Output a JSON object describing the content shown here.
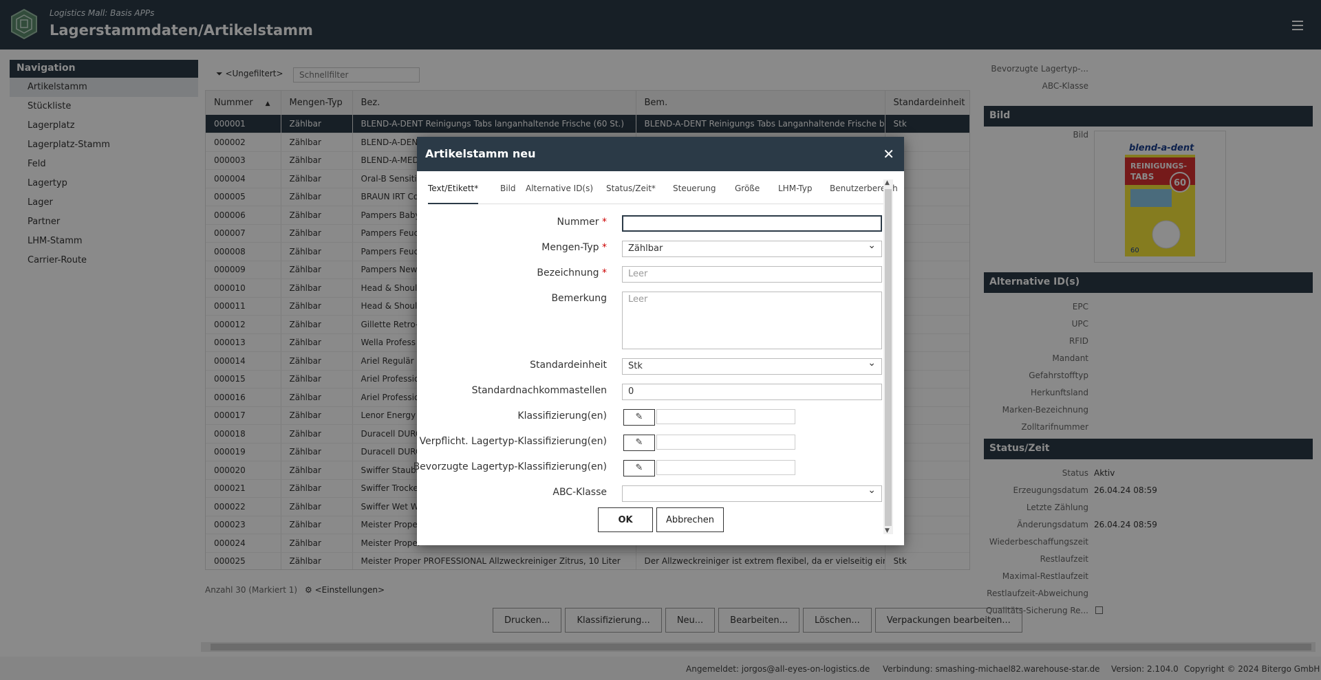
{
  "header": {
    "subtitle": "Logistics Mall: Basis APPs",
    "title": "Lagerstammdaten/Artikelstamm"
  },
  "nav": {
    "heading": "Navigation",
    "items": [
      "Artikelstamm",
      "Stückliste",
      "Lagerplatz",
      "Lagerplatz-Stamm",
      "Feld",
      "Lagertyp",
      "Lager",
      "Partner",
      "LHM-Stamm",
      "Carrier-Route"
    ]
  },
  "toolbar": {
    "filter_label": "<Ungefiltert>",
    "quickfilter_placeholder": "Schnellfilter"
  },
  "table": {
    "columns": [
      "Nummer",
      "Mengen-Typ",
      "Bez.",
      "Bem.",
      "Standardeinheit"
    ],
    "rows": [
      [
        "000001",
        "Zählbar",
        "BLEND-A-DENT Reinigungs Tabs langanhaltende Frische (60 St.)",
        "BLEND-A-DENT Reinigungs Tabs Langanhaltende Frische biet",
        "Stk"
      ],
      [
        "000002",
        "Zählbar",
        "BLEND-A-DENT",
        "",
        ""
      ],
      [
        "000003",
        "Zählbar",
        "BLEND-A-MED",
        "",
        ""
      ],
      [
        "000004",
        "Zählbar",
        "Oral-B Sensitiv",
        "",
        ""
      ],
      [
        "000005",
        "Zählbar",
        "BRAUN IRT Co",
        "",
        ""
      ],
      [
        "000006",
        "Zählbar",
        "Pampers Baby",
        "",
        ""
      ],
      [
        "000007",
        "Zählbar",
        "Pampers Feuc",
        "",
        ""
      ],
      [
        "000008",
        "Zählbar",
        "Pampers Feuc",
        "",
        ""
      ],
      [
        "000009",
        "Zählbar",
        "Pampers New",
        "",
        ""
      ],
      [
        "000010",
        "Zählbar",
        "Head & Should",
        "",
        ""
      ],
      [
        "000011",
        "Zählbar",
        "Head & Should",
        "",
        ""
      ],
      [
        "000012",
        "Zählbar",
        "Gillette Retro-",
        "",
        ""
      ],
      [
        "000013",
        "Zählbar",
        "Wella Profess",
        "",
        ""
      ],
      [
        "000014",
        "Zählbar",
        "Ariel Regulär (",
        "",
        ""
      ],
      [
        "000015",
        "Zählbar",
        "Ariel Professio",
        "",
        ""
      ],
      [
        "000016",
        "Zählbar",
        "Ariel Professio",
        "",
        ""
      ],
      [
        "000017",
        "Zählbar",
        "Lenor Energy",
        "",
        ""
      ],
      [
        "000018",
        "Zählbar",
        "Duracell DURC",
        "",
        ""
      ],
      [
        "000019",
        "Zählbar",
        "Duracell DURC",
        "",
        ""
      ],
      [
        "000020",
        "Zählbar",
        "Swiffer Staubr",
        "",
        ""
      ],
      [
        "000021",
        "Zählbar",
        "Swiffer Trocke",
        "",
        ""
      ],
      [
        "000022",
        "Zählbar",
        "Swiffer Wet W",
        "",
        ""
      ],
      [
        "000023",
        "Zählbar",
        "Meister Proper",
        "",
        ""
      ],
      [
        "000024",
        "Zählbar",
        "Meister Proper",
        "",
        ""
      ],
      [
        "000025",
        "Zählbar",
        "Meister Proper PROFESSIONAL Allzweckreiniger Zitrus, 10 Liter",
        "Der Allzweckreiniger ist extrem flexibel, da er vielseitig einse",
        "Stk"
      ]
    ],
    "count_label": "Anzahl 30 (Markiert 1)",
    "settings_label": "<Einstellungen>"
  },
  "actions": [
    "Drucken...",
    "Klassifizierung...",
    "Neu...",
    "Bearbeiten...",
    "Löschen...",
    "Verpackungen bearbeiten..."
  ],
  "footer": {
    "user": "Angemeldet: jorgos@all-eyes-on-logistics.de",
    "connection": "Verbindung: smashing-michael82.warehouse-star.de",
    "version": "Version: 2.104.0",
    "copyright": "Copyright © 2024 Bitergo GmbH"
  },
  "right_panel": {
    "top_rows": [
      {
        "k": "Bevorzugte Lagertyp-...",
        "v": ""
      },
      {
        "k": "ABC-Klasse",
        "v": ""
      }
    ],
    "bild_heading": "Bild",
    "bild_label": "Bild",
    "product_image": {
      "brand": "blend-a-dent",
      "line1": "REINIGUNGS-",
      "line2": "TABS",
      "count": "60"
    },
    "alt_heading": "Alternative ID(s)",
    "alt_rows": [
      {
        "k": "EPC",
        "v": ""
      },
      {
        "k": "UPC",
        "v": ""
      },
      {
        "k": "RFID",
        "v": ""
      },
      {
        "k": "Mandant",
        "v": ""
      },
      {
        "k": "Gefahrstofftyp",
        "v": ""
      },
      {
        "k": "Herkunftsland",
        "v": ""
      },
      {
        "k": "Marken-Bezeichnung",
        "v": ""
      },
      {
        "k": "Zolltarifnummer",
        "v": ""
      }
    ],
    "status_heading": "Status/Zeit",
    "status_rows": [
      {
        "k": "Status",
        "v": "Aktiv"
      },
      {
        "k": "Erzeugungsdatum",
        "v": "26.04.24 08:59"
      },
      {
        "k": "Letzte Zählung",
        "v": ""
      },
      {
        "k": "Änderungsdatum",
        "v": "26.04.24 08:59"
      },
      {
        "k": "Wiederbeschaffungszeit",
        "v": ""
      },
      {
        "k": "Restlaufzeit",
        "v": ""
      },
      {
        "k": "Maximal-Restlaufzeit",
        "v": ""
      },
      {
        "k": "Restlaufzeit-Abweichung",
        "v": ""
      },
      {
        "k": "Qualitäts-Sicherung Re...",
        "v": ""
      }
    ]
  },
  "dialog": {
    "title": "Artikelstamm neu",
    "tabs": [
      "Text/Etikett*",
      "Bild",
      "Alternative ID(s)",
      "Status/Zeit*",
      "Steuerung",
      "Größe",
      "LHM-Typ",
      "Benutzerbereich"
    ],
    "fields": {
      "nummer_label": "Nummer",
      "nummer_value": "",
      "mengentyp_label": "Mengen-Typ",
      "mengentyp_value": "Zählbar",
      "bezeichnung_label": "Bezeichnung",
      "bezeichnung_placeholder": "Leer",
      "bemerkung_label": "Bemerkung",
      "bemerkung_placeholder": "Leer",
      "standardeinheit_label": "Standardeinheit",
      "standardeinheit_value": "Stk",
      "nachkomma_label": "Standardnachkommastellen",
      "nachkomma_value": "0",
      "klass_label": "Klassifizierung(en)",
      "verpf_label": "Verpflicht. Lagertyp-Klassifizierung(en)",
      "bevorz_label": "Bevorzugte Lagertyp-Klassifizierung(en)",
      "abc_label": "ABC-Klasse",
      "abc_value": ""
    },
    "required_marker": "*",
    "ok_label": "OK",
    "cancel_label": "Abbrechen",
    "close_glyph": "✕"
  }
}
